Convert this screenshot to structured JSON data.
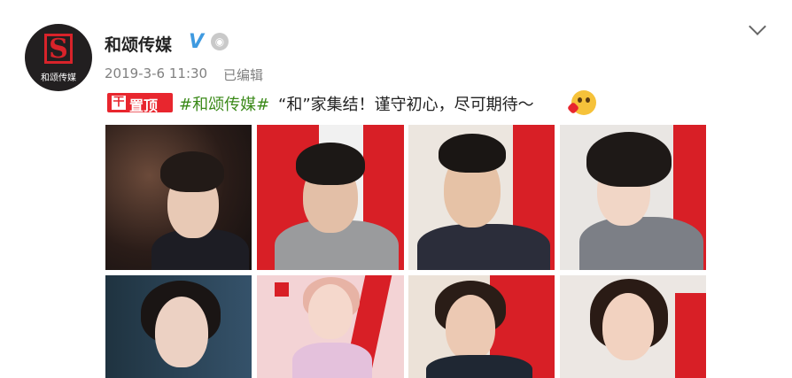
{
  "header": {
    "account_name": "和颂传媒",
    "verified_mark": "V",
    "avatar_logo_letter": "S",
    "avatar_logo_text": "和颂传媒",
    "timestamp": "2019-3-6 11:30",
    "edited_label": "已编辑"
  },
  "post": {
    "top_tag_icon": "干",
    "top_tag_label": "置顶",
    "hashtag": "#和颂传媒#",
    "text": " “和”家集结！谨守初心，尽可期待～"
  },
  "icons": {
    "more": "chevron-down-icon",
    "verified": "verified-v-icon",
    "robot": "robot-icon",
    "pin": "pin-top-icon",
    "emoji": "blush-emoji-icon"
  },
  "colors": {
    "accent_red": "#e8262e",
    "hashtag_green": "#3b8a19",
    "verified_blue": "#3f9ae0",
    "meta_gray": "#808080"
  }
}
